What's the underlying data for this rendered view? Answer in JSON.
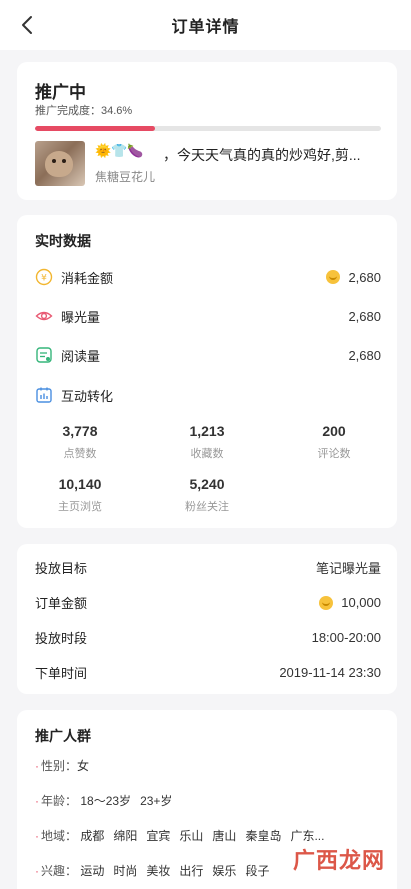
{
  "header": {
    "title": "订单详情"
  },
  "status_card": {
    "status": "推广中",
    "progress_label": "推广完成度：34.6%",
    "progress_fraction": 0.346,
    "post_emoji": "🌞👕🍆",
    "post_title": "，今天天气真的真的炒鸡好,剪...",
    "author": "焦糖豆花儿"
  },
  "realtime": {
    "title": "实时数据",
    "rows": [
      {
        "label": "消耗金额",
        "value": "2,680",
        "icon": "yuan-coin-icon",
        "has_coin": true
      },
      {
        "label": "曝光量",
        "value": "2,680",
        "icon": "eye-icon",
        "has_coin": false
      },
      {
        "label": "阅读量",
        "value": "2,680",
        "icon": "read-doc-icon",
        "has_coin": false
      }
    ],
    "interaction_title": "互动转化",
    "stats": [
      {
        "num": "3,778",
        "label": "点赞数"
      },
      {
        "num": "1,213",
        "label": "收藏数"
      },
      {
        "num": "200",
        "label": "评论数"
      },
      {
        "num": "10,140",
        "label": "主页浏览"
      },
      {
        "num": "5,240",
        "label": "粉丝关注"
      }
    ]
  },
  "order_info": {
    "rows": [
      {
        "key": "投放目标",
        "value": "笔记曝光量"
      },
      {
        "key": "订单金额",
        "value": "10,000"
      },
      {
        "key": "投放时段",
        "value": "18:00-20:00"
      },
      {
        "key": "下单时间",
        "value": "2019-11-14 23:30"
      }
    ]
  },
  "audience": {
    "title": "推广人群",
    "gender_key": "性别：",
    "gender": "女",
    "age_key": "年龄：",
    "ages": [
      "18～23岁",
      "23+岁"
    ],
    "region_key": "地域：",
    "regions": [
      "成都",
      "绵阳",
      "宜宾",
      "乐山",
      "唐山",
      "秦皇岛",
      "广东..."
    ],
    "interest_key": "兴趣：",
    "interests": [
      "运动",
      "时尚",
      "美妆",
      "出行",
      "娱乐",
      "段子"
    ]
  },
  "watermark": {
    "text": "广西龙网"
  },
  "colors": {
    "accent": "#e64a63",
    "coin": "#f7c23b",
    "icon_yellow": "#f2b630",
    "icon_pink": "#e85a73",
    "icon_green": "#35b57a",
    "icon_blue": "#4a8fe0"
  }
}
